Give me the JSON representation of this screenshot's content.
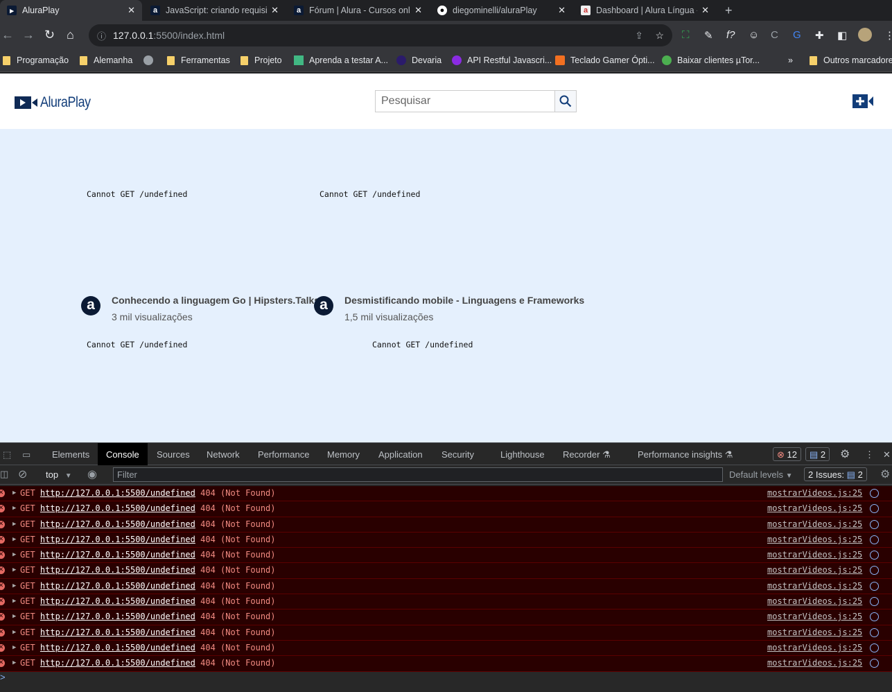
{
  "browser": {
    "tabs": [
      {
        "title": "AluraPlay",
        "active": true
      },
      {
        "title": "JavaScript: criando requisições"
      },
      {
        "title": "Fórum | Alura - Cursos online"
      },
      {
        "title": "diegominelli/aluraPlay"
      },
      {
        "title": "Dashboard | Alura Língua -"
      }
    ],
    "new_tab": "+",
    "url_host": "127.0.0.1",
    "url_rest": ":5500/index.html",
    "bookmarks": [
      "Programação",
      "Alemanha",
      "",
      "Ferramentas",
      "Projeto",
      "Aprenda a testar A...",
      "Devaria",
      "API Restful Javascri...",
      "Teclado Gamer Ópti...",
      "Baixar clientes µTor..."
    ],
    "more": "»",
    "other_bookmarks": "Outros marcadores"
  },
  "page": {
    "logo": "AluraPlay",
    "search_placeholder": "Pesquisar",
    "error_text": "Cannot GET /undefined",
    "videos": [
      {
        "title": "Conhecendo a linguagem Go | Hipsters.Talks",
        "views": "3 mil visualizações",
        "avatar": "a"
      },
      {
        "title": "Desmistificando mobile - Linguagens e Frameworks",
        "views": "1,5 mil visualizações",
        "avatar": "a"
      }
    ]
  },
  "devtools": {
    "tabs": [
      "Elements",
      "Console",
      "Sources",
      "Network",
      "Performance",
      "Memory",
      "Application",
      "Security",
      "Lighthouse",
      "Recorder",
      "Performance insights"
    ],
    "active_tab": "Console",
    "error_count": "12",
    "message_count": "2",
    "context": "top",
    "filter_placeholder": "Filter",
    "levels": "Default levels",
    "issues": "2 Issues:",
    "issues_count": "2",
    "log": {
      "method": "GET",
      "url": "http://127.0.0.1:5500/undefined",
      "status": "404 (Not Found)",
      "source": "mostrarVideos.js:25",
      "count": 12
    },
    "prompt": ">"
  },
  "colors": {
    "accent": "#123d79",
    "error_bg": "#290000",
    "error_text": "#f28b82"
  }
}
